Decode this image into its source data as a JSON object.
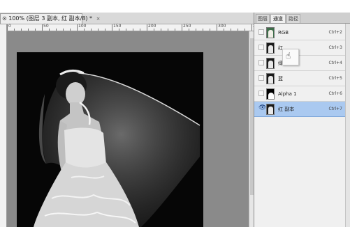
{
  "document": {
    "tab_title": "⊙ 100% (图层 3 副本, 红 副本/8) *",
    "close_glyph": "×",
    "ruler_marks": [
      "0",
      "50",
      "100",
      "150",
      "200",
      "250",
      "300",
      "350",
      "400",
      "450",
      "500",
      "550",
      "600",
      "650",
      "700"
    ]
  },
  "panel": {
    "tabs": [
      "图层",
      "通道",
      "路径"
    ],
    "active_tab": "通道",
    "channels": [
      {
        "name": "RGB",
        "shortcut": "Ctrl+2",
        "visible": false,
        "selected": false,
        "thumb": "rgb"
      },
      {
        "name": "红",
        "shortcut": "Ctrl+3",
        "visible": false,
        "selected": false,
        "thumb": "gray"
      },
      {
        "name": "绿",
        "shortcut": "Ctrl+4",
        "visible": false,
        "selected": false,
        "thumb": "gray"
      },
      {
        "name": "蓝",
        "shortcut": "Ctrl+5",
        "visible": false,
        "selected": false,
        "thumb": "gray"
      },
      {
        "name": "Alpha 1",
        "shortcut": "Ctrl+6",
        "visible": false,
        "selected": false,
        "thumb": "alpha"
      },
      {
        "name": "红 副本",
        "shortcut": "Ctrl+7",
        "visible": true,
        "selected": true,
        "thumb": "gray"
      }
    ],
    "eye_glyph": "👁"
  },
  "colors": {
    "canvas_bg": "#8a8a8a",
    "selected_row": "#aac9f0",
    "photo_bg": "#060606"
  },
  "cursor_glyph": "☝"
}
